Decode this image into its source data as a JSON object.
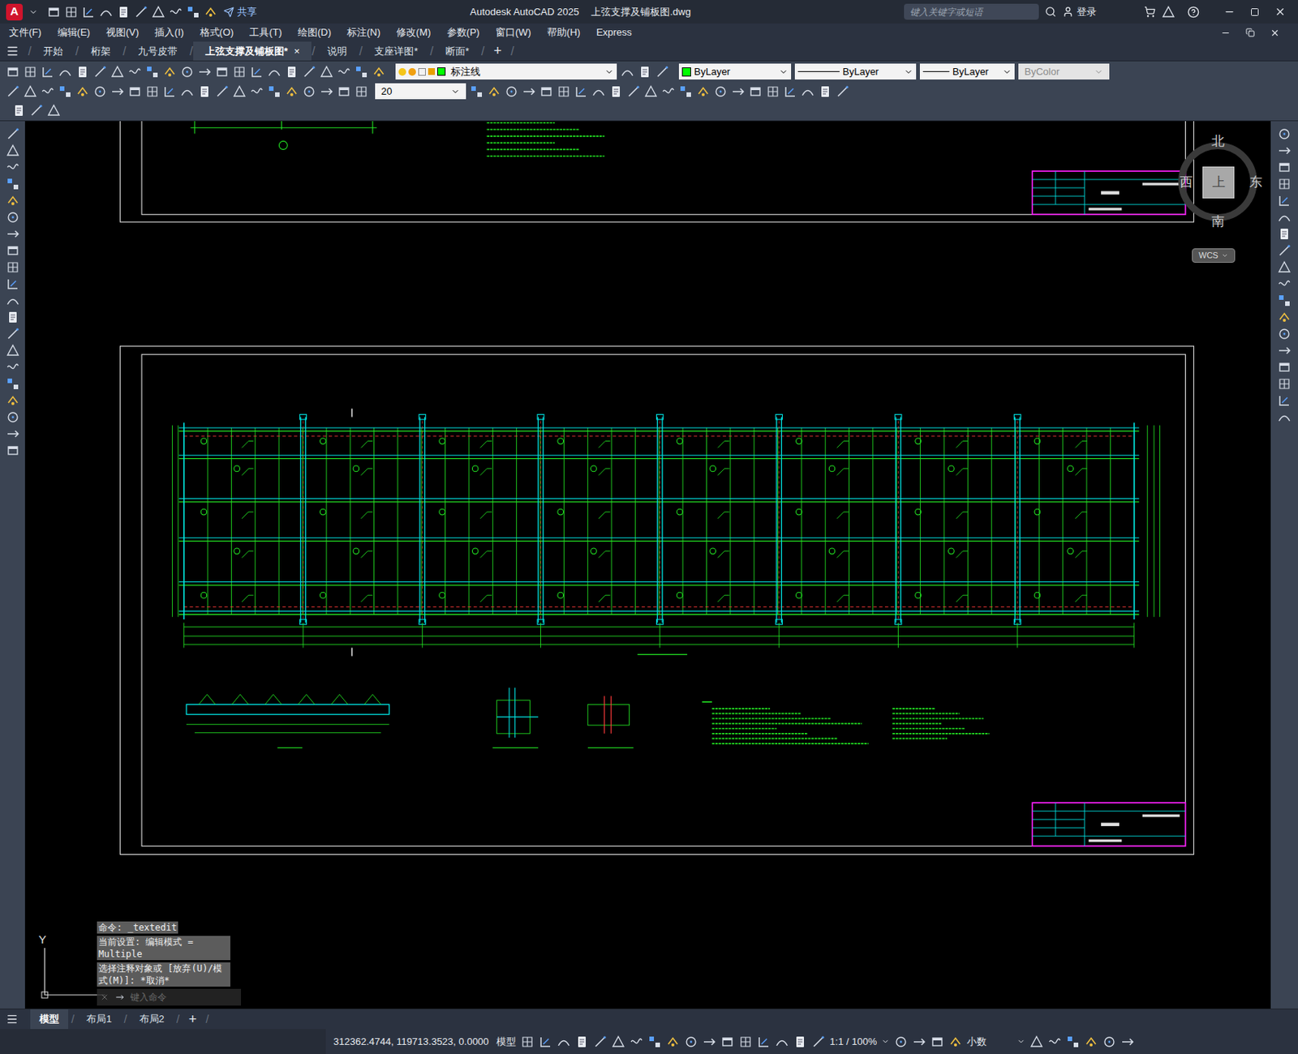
{
  "window": {
    "logo": "A",
    "share": "共享",
    "title": "Autodesk AutoCAD 2025",
    "file": "上弦支撑及铺板图.dwg",
    "search_placeholder": "键入关键字或短语",
    "login": "登录"
  },
  "menus": [
    "文件(F)",
    "编辑(E)",
    "视图(V)",
    "插入(I)",
    "格式(O)",
    "工具(T)",
    "绘图(D)",
    "标注(N)",
    "修改(M)",
    "参数(P)",
    "窗口(W)",
    "帮助(H)",
    "Express"
  ],
  "file_tabs": [
    {
      "label": "开始",
      "selected": false
    },
    {
      "label": "桁架",
      "selected": false
    },
    {
      "label": "九号皮带",
      "selected": false
    },
    {
      "label": "上弦支撑及铺板图*",
      "selected": true
    },
    {
      "label": "说明",
      "selected": false
    },
    {
      "label": "支座详图*",
      "selected": false
    },
    {
      "label": "断面*",
      "selected": false
    }
  ],
  "tab_close": "×",
  "new_tab": "+",
  "properties": {
    "layer": "标注线",
    "layer_color": "#00ff00",
    "color": "ByLayer",
    "color_swatch": "#00ff00",
    "linetype": "ByLayer",
    "lineweight": "ByLayer",
    "plotstyle": {
      "label": "ByColor",
      "disabled": true
    }
  },
  "dim_scale": "20",
  "viewcube": {
    "north": "北",
    "south": "南",
    "east": "东",
    "west": "西",
    "face": "上",
    "ucs": "WCS"
  },
  "ucs_icon": {
    "y": "Y"
  },
  "command_line": {
    "history": [
      "命令: _textedit",
      "当前设置: 编辑模式 = Multiple",
      "选择注释对象或 [放弃(U)/模式(M)]: *取消*"
    ],
    "placeholder": "键入命令"
  },
  "layout_tabs": [
    {
      "label": "模型",
      "selected": true
    },
    {
      "label": "布局1",
      "selected": false
    },
    {
      "label": "布局2",
      "selected": false
    }
  ],
  "new_layout": "+",
  "status_bar": {
    "coords": "312362.4744, 119713.3523, 0.0000",
    "space": "模型",
    "scale": "1:1 / 100%",
    "units": "小数"
  }
}
